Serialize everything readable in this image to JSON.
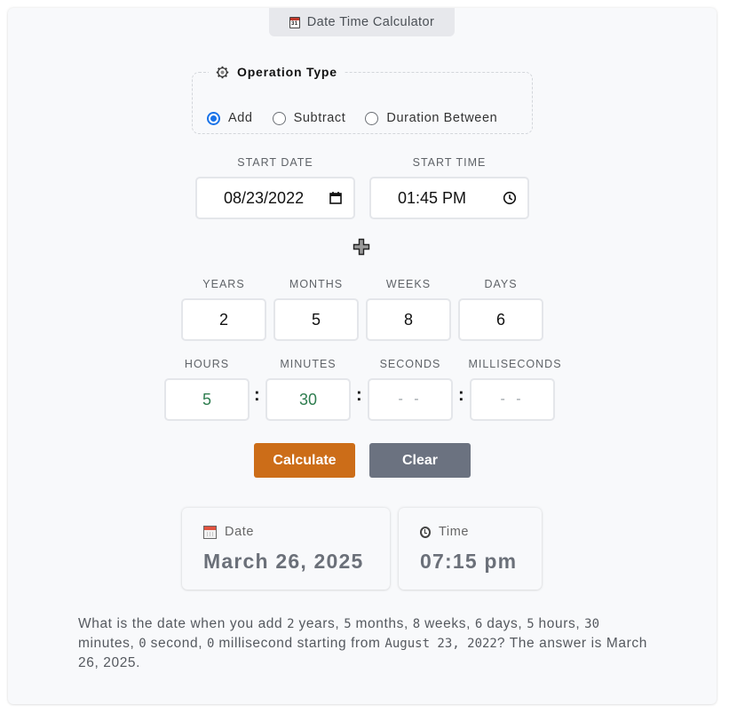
{
  "app": {
    "title": "Date Time Calculator",
    "title_icon": "calendar-icon"
  },
  "operation": {
    "legend": "Operation Type",
    "legend_icon": "gear-icon",
    "options": [
      {
        "label": "Add",
        "checked": true
      },
      {
        "label": "Subtract",
        "checked": false
      },
      {
        "label": "Duration Between",
        "checked": false
      }
    ]
  },
  "start": {
    "date_label": "START DATE",
    "date_value": "08/23/2022",
    "time_label": "START TIME",
    "time_value": "01:45 PM"
  },
  "operator_icon": "plus-icon",
  "duration": {
    "years": {
      "label": "YEARS",
      "value": "2"
    },
    "months": {
      "label": "MONTHS",
      "value": "5"
    },
    "weeks": {
      "label": "WEEKS",
      "value": "8"
    },
    "days": {
      "label": "DAYS",
      "value": "6"
    },
    "hours": {
      "label": "HOURS",
      "value": "5"
    },
    "minutes": {
      "label": "MINUTES",
      "value": "30"
    },
    "seconds": {
      "label": "SECONDS",
      "value": "",
      "placeholder": "--"
    },
    "milliseconds": {
      "label": "MILLISECONDS",
      "value": "",
      "placeholder": "--"
    },
    "separator": ":"
  },
  "buttons": {
    "calculate": "Calculate",
    "clear": "Clear"
  },
  "colors": {
    "calculate_bg": "#cc6d18",
    "clear_bg": "#6b7280",
    "radio_accent": "#1a73e8",
    "time_value_color": "#2e7d4f"
  },
  "result": {
    "date_label": "Date",
    "date_value": "March 26, 2025",
    "time_label": "Time",
    "time_value": "07:15 pm"
  },
  "description": {
    "p1": "What is the date when you add ",
    "years": "2",
    "p2": " years, ",
    "months": "5",
    "p3": " months, ",
    "weeks": "8",
    "p4": " weeks, ",
    "days": "6",
    "p5": " days, ",
    "hours": "5",
    "p6": " hours, ",
    "minutes": "30",
    "p7": " minutes, ",
    "seconds": "0",
    "p8": " second, ",
    "milliseconds": "0",
    "p9": " millisecond starting from ",
    "start_date": "August 23, 2022",
    "p10": "? The answer is March 26, 2025."
  }
}
